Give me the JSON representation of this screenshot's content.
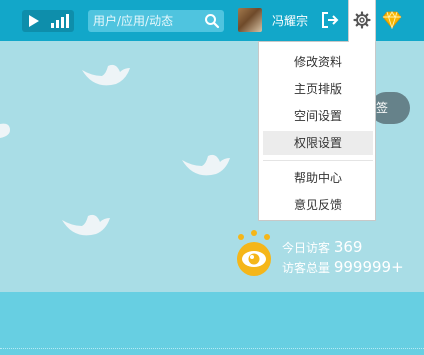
{
  "topbar": {
    "search": {
      "placeholder": "用户/应用/动态"
    },
    "user": {
      "name": "冯耀宗"
    }
  },
  "menu": {
    "items": [
      {
        "label": "修改资料"
      },
      {
        "label": "主页排版"
      },
      {
        "label": "空间设置"
      },
      {
        "label": "权限设置",
        "active": true
      },
      {
        "label": "帮助中心"
      },
      {
        "label": "意见反馈"
      }
    ]
  },
  "background": {
    "pill_label": "签"
  },
  "visits": {
    "today_label": "今日访客",
    "today_value": "369",
    "total_label": "访客总量",
    "total_value": "999999+"
  },
  "colors": {
    "topbar": "#12a7c9",
    "background": "#a9dde6",
    "bottom_band": "#67cfe2",
    "eye_icon": "#f5b619"
  }
}
